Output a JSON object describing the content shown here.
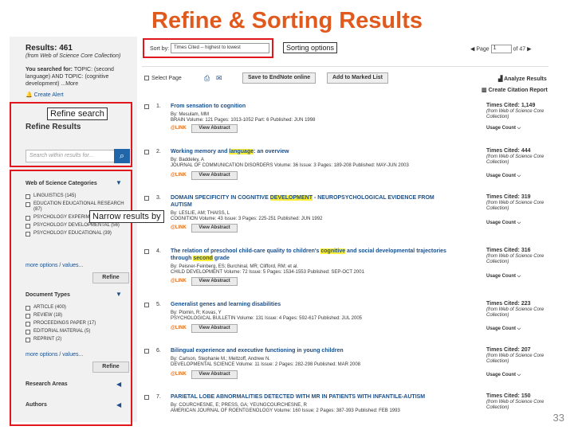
{
  "slide_title": "Refine & Sorting Results",
  "page_number": "33",
  "sidebar": {
    "results_count": "Results: 461",
    "results_source": "(from Web of Science Core Collection)",
    "searched_for_label": "You searched for:",
    "searched_for_query": "TOPIC: (second language) AND TOPIC: (cognitive development) ...More",
    "create_alert": "Create Alert",
    "refine_results": "Refine Results",
    "search_within_placeholder": "Search within results for...",
    "search_icon": "magnifier-icon",
    "wos_categories": {
      "title": "Web of Science Categories",
      "items": [
        "LINGUISTICS (145)",
        "EDUCATION EDUCATIONAL RESEARCH (87)",
        "PSYCHOLOGY EXPERIMENTAL (68)",
        "PSYCHOLOGY DEVELOPMENTAL (56)",
        "PSYCHOLOGY EDUCATIONAL (39)"
      ],
      "more_options": "more options / values...",
      "refine": "Refine"
    },
    "document_types": {
      "title": "Document Types",
      "items": [
        "ARTICLE (400)",
        "REVIEW (18)",
        "PROCEEDINGS PAPER (17)",
        "EDITORIAL MATERIAL (5)",
        "REPRINT (2)"
      ],
      "more_options": "more options / values...",
      "refine": "Refine"
    },
    "research_areas": "Research Areas",
    "authors": "Authors"
  },
  "sort": {
    "label": "Sort by:",
    "selected": "Times Cited -- highest to lowest"
  },
  "pager": {
    "page_label": "Page",
    "page_value": "1",
    "of_label": "of 47"
  },
  "toolbar": {
    "select_page": "Select Page",
    "save_endnote": "Save to EndNote online",
    "add_marked": "Add to Marked List",
    "analyze": "Analyze Results",
    "citation_report": "Create Citation Report"
  },
  "records": [
    {
      "num": "1.",
      "title": "From sensation to cognition",
      "meta1": "By: Mesulam, MM",
      "meta2": "BRAIN   Volume: 121   Pages: 1013-1052   Part: 6   Published: JUN 1998",
      "times_cited": "Times Cited: 1,149",
      "usage": "Usage Count"
    },
    {
      "num": "2.",
      "title_pre": "Working memory and ",
      "title_hl": "language",
      "title_post": ": an overview",
      "meta1": "By: Baddeley, A",
      "meta2": "JOURNAL OF COMMUNICATION DISORDERS   Volume: 36   Issue: 3   Pages: 189-208   Published: MAY-JUN 2003",
      "times_cited": "Times Cited: 444",
      "usage": "Usage Count"
    },
    {
      "num": "3.",
      "title_pre": "DOMAIN SPECIFICITY IN COGNITIVE ",
      "title_hl": "DEVELOPMENT",
      "title_post": " - NEUROPSYCHOLOGICAL EVIDENCE FROM AUTISM",
      "meta1": "By: LESLIE, AM; THAISS, L",
      "meta2": "COGNITION   Volume: 43   Issue: 3   Pages: 225-251   Published: JUN 1992",
      "times_cited": "Times Cited: 319",
      "usage": "Usage Count"
    },
    {
      "num": "4.",
      "title_pre": "The relation of preschool child-care quality to children's ",
      "title_hl": "cognitive",
      "title_mid": " and social developmental trajectories through ",
      "title_hl2": "second",
      "title_post": " grade",
      "meta1": "By: Peisner-Feinberg, ES; Burchinal, MR; Clifford, RM; et al.",
      "meta2": "CHILD DEVELOPMENT   Volume: 72   Issue: 5   Pages: 1534-1553   Published: SEP-OCT 2001",
      "times_cited": "Times Cited: 316",
      "usage": "Usage Count"
    },
    {
      "num": "5.",
      "title": "Generalist genes and learning disabilities",
      "meta1": "By: Plomin, R; Kovas, Y",
      "meta2": "PSYCHOLOGICAL BULLETIN   Volume: 131   Issue: 4   Pages: 592-617   Published: JUL 2005",
      "times_cited": "Times Cited: 223",
      "usage": "Usage Count"
    },
    {
      "num": "6.",
      "title": "Bilingual experience and executive functioning in young children",
      "meta1": "By: Carlson, Stephanie M.; Meltzoff, Andrew N.",
      "meta2": "DEVELOPMENTAL SCIENCE   Volume: 11   Issue: 2   Pages: 282-298   Published: MAR 2008",
      "times_cited": "Times Cited: 207",
      "usage": "Usage Count"
    },
    {
      "num": "7.",
      "title": "PARIETAL LOBE ABNORMALITIES DETECTED WITH MR IN PATIENTS WITH INFANTILE-AUTISM",
      "meta1": "By: COURCHESNE, E; PRESS, GA; YEUNGCOURCHESNE, R",
      "meta2": "AMERICAN JOURNAL OF ROENTGENOLOGY   Volume: 160   Issue: 2   Pages: 387-393   Published: FEB 1993",
      "times_cited": "Times Cited: 150",
      "usage": "Usage Count"
    }
  ],
  "cited_source": "(from Web of Science Core Collection)",
  "gift_label": "@LINK",
  "view_abstract": "View Abstract",
  "callouts": {
    "sorting": "Sorting options",
    "refine": "Refine search",
    "narrow": "Narrow results by"
  },
  "colors": {
    "title": "#e05a1e",
    "annotation": "#e0181e",
    "link": "#1a4f8a",
    "highlight": "#ffef3a"
  }
}
